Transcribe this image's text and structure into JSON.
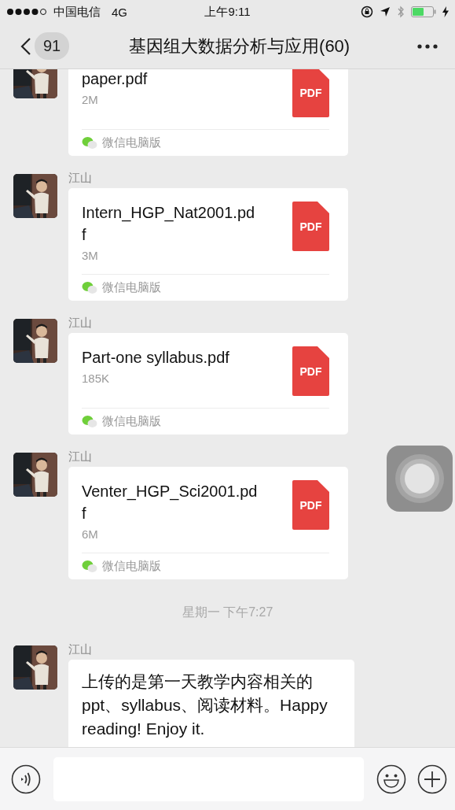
{
  "status_bar": {
    "carrier": "中国电信",
    "network": "4G",
    "time": "上午9:11"
  },
  "nav": {
    "back_count": "91",
    "title": "基因组大数据分析与应用(60)"
  },
  "messages": [
    {
      "kind": "file",
      "title_lines": [
        "paper.pdf"
      ],
      "size": "2M",
      "file_type": "PDF",
      "source": "微信电脑版"
    },
    {
      "kind": "file",
      "sender": "江山",
      "title_lines": [
        "Intern_HGP_Nat2001.pd",
        "f"
      ],
      "size": "3M",
      "file_type": "PDF",
      "source": "微信电脑版"
    },
    {
      "kind": "file",
      "sender": "江山",
      "title_lines": [
        "Part-one syllabus.pdf"
      ],
      "size": "185K",
      "file_type": "PDF",
      "source": "微信电脑版"
    },
    {
      "kind": "file",
      "sender": "江山",
      "title_lines": [
        "Venter_HGP_Sci2001.pd",
        "f"
      ],
      "size": "6M",
      "file_type": "PDF",
      "source": "微信电脑版"
    },
    {
      "kind": "time",
      "text": "星期一 下午7:27"
    },
    {
      "kind": "text",
      "sender": "江山",
      "lines": [
        "上传的是第一天教学内容相关的",
        "ppt、syllabus、阅读材料。Happy",
        "reading! Enjoy it."
      ]
    }
  ]
}
